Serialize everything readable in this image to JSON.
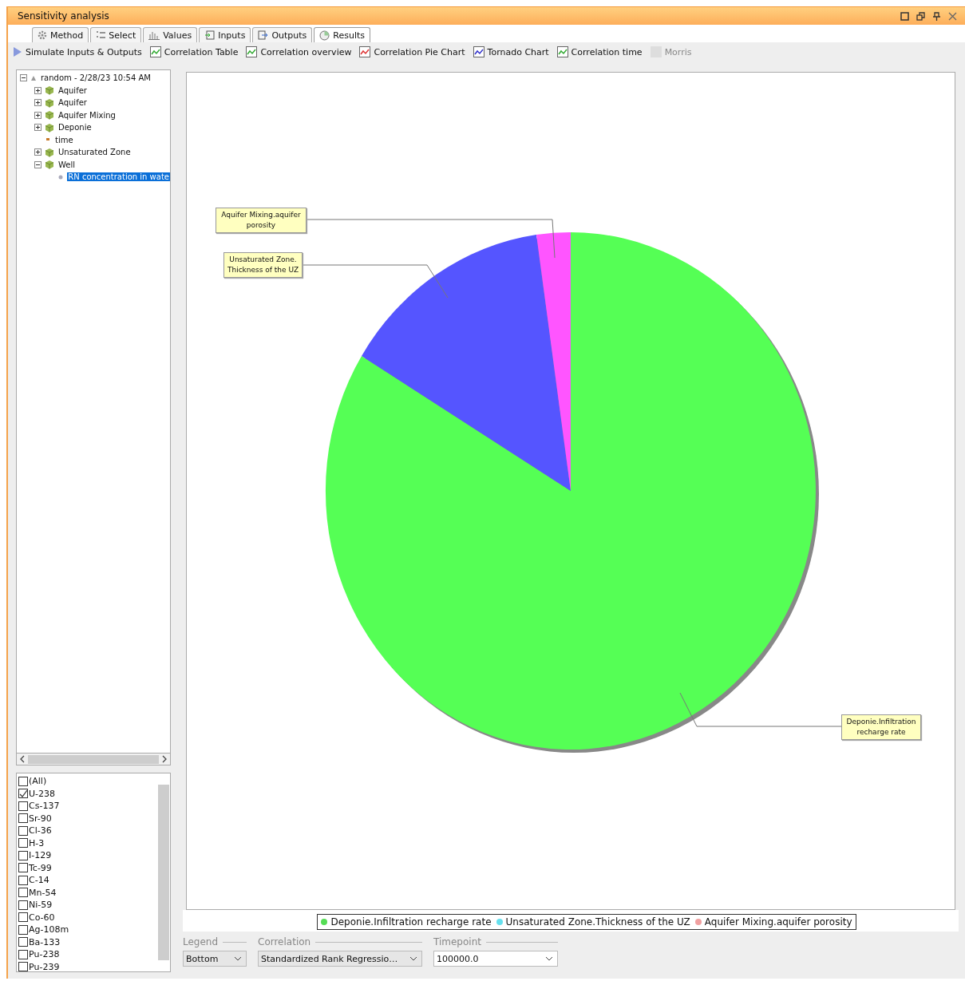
{
  "window": {
    "title": "Sensitivity analysis"
  },
  "tabs": [
    {
      "label": "Method",
      "selected": false
    },
    {
      "label": "Select",
      "selected": false
    },
    {
      "label": "Values",
      "selected": false
    },
    {
      "label": "Inputs",
      "selected": false
    },
    {
      "label": "Outputs",
      "selected": false
    },
    {
      "label": "Results",
      "selected": true
    }
  ],
  "toolbar": [
    {
      "label": "Simulate Inputs & Outputs",
      "disabled": false
    },
    {
      "label": "Correlation Table",
      "disabled": false
    },
    {
      "label": "Correlation overview",
      "disabled": false
    },
    {
      "label": "Correlation Pie Chart",
      "disabled": false
    },
    {
      "label": "Tornado Chart",
      "disabled": false
    },
    {
      "label": "Correlation time",
      "disabled": false
    },
    {
      "label": "Morris",
      "disabled": true
    }
  ],
  "tree": [
    {
      "label": "random - 2/28/23 10:54 AM",
      "kind": "run",
      "expanded": true,
      "selected": false,
      "children": [
        {
          "label": "Aquifer",
          "kind": "group",
          "expanded": false,
          "selected": false
        },
        {
          "label": "Aquifer",
          "kind": "group",
          "expanded": false,
          "selected": false
        },
        {
          "label": "Aquifer Mixing",
          "kind": "group",
          "expanded": false,
          "selected": false
        },
        {
          "label": "Deponie",
          "kind": "group",
          "expanded": false,
          "selected": false
        },
        {
          "label": "time",
          "kind": "value",
          "selected": false
        },
        {
          "label": "Unsaturated Zone",
          "kind": "group",
          "expanded": false,
          "selected": false
        },
        {
          "label": "Well",
          "kind": "group",
          "expanded": true,
          "selected": false,
          "children": [
            {
              "label": "RN concentration in wate",
              "kind": "output",
              "selected": true
            }
          ]
        }
      ]
    }
  ],
  "nuclides": [
    {
      "label": "(All)",
      "checked": false
    },
    {
      "label": "U-238",
      "checked": true
    },
    {
      "label": "Cs-137",
      "checked": false
    },
    {
      "label": "Sr-90",
      "checked": false
    },
    {
      "label": "Cl-36",
      "checked": false
    },
    {
      "label": "H-3",
      "checked": false
    },
    {
      "label": "I-129",
      "checked": false
    },
    {
      "label": "Tc-99",
      "checked": false
    },
    {
      "label": "C-14",
      "checked": false
    },
    {
      "label": "Mn-54",
      "checked": false
    },
    {
      "label": "Ni-59",
      "checked": false
    },
    {
      "label": "Co-60",
      "checked": false
    },
    {
      "label": "Ag-108m",
      "checked": false
    },
    {
      "label": "Ba-133",
      "checked": false
    },
    {
      "label": "Pu-238",
      "checked": false
    },
    {
      "label": "Pu-239",
      "checked": false
    }
  ],
  "pie_labels": [
    "Aquifer Mixing.aquifer porosity",
    "Unsaturated Zone. Thickness of the UZ",
    "Deponie.Infiltration recharge rate"
  ],
  "legend": [
    {
      "label": "Deponie.Infiltration recharge rate",
      "color": "#55dd55"
    },
    {
      "label": "Unsaturated Zone.Thickness of the UZ",
      "color": "#66e0ee"
    },
    {
      "label": "Aquifer Mixing.aquifer porosity",
      "color": "#f0a0a0"
    }
  ],
  "controls": [
    {
      "label": "Legend",
      "value": "Bottom"
    },
    {
      "label": "Correlation",
      "value": "Standardized Rank Regressio…"
    },
    {
      "label": "Timepoint",
      "value": "100000.0"
    }
  ]
}
